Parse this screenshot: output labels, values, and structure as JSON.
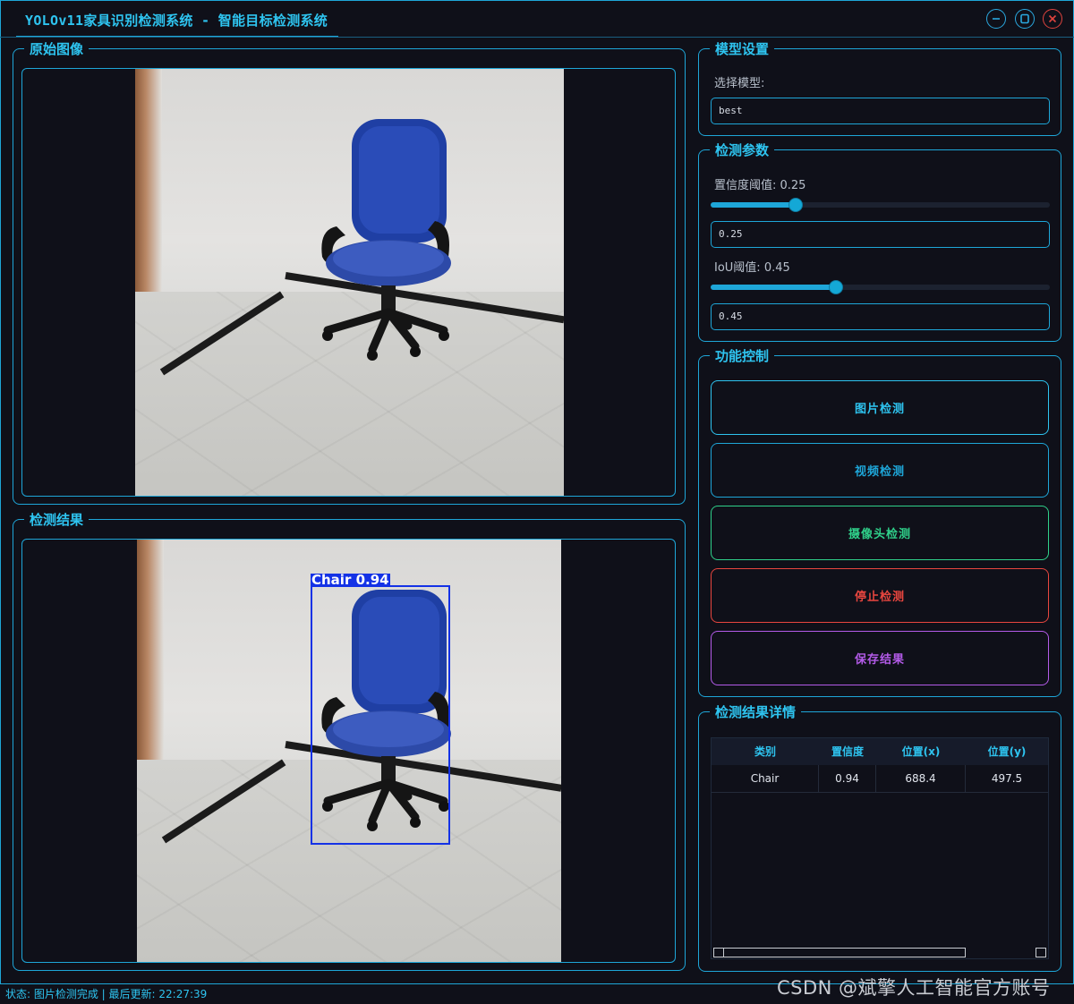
{
  "window": {
    "title": "YOLOv11家具识别检测系统 - 智能目标检测系统"
  },
  "original_panel": {
    "title": "原始图像"
  },
  "result_panel": {
    "title": "检测结果",
    "detection_label": "Chair 0.94"
  },
  "model_settings": {
    "title": "模型设置",
    "select_label": "选择模型:",
    "selected_model": "best"
  },
  "detect_params": {
    "title": "检测参数",
    "confidence_label": "置信度阈值: 0.25",
    "confidence_value": "0.25",
    "confidence_level": 0.25,
    "iou_label": "IoU阈值: 0.45",
    "iou_value": "0.45",
    "iou_level": 0.45
  },
  "controls": {
    "title": "功能控制",
    "buttons": [
      {
        "label": "图片检测",
        "color": "#2ec4f0"
      },
      {
        "label": "视频检测",
        "color": "#1ea6d8"
      },
      {
        "label": "摄像头检测",
        "color": "#2fd08a"
      },
      {
        "label": "停止检测",
        "color": "#e8463f"
      },
      {
        "label": "保存结果",
        "color": "#b35be8"
      }
    ]
  },
  "results_table": {
    "title": "检测结果详情",
    "columns": [
      "类别",
      "置信度",
      "位置(x)",
      "位置(y)"
    ],
    "rows": [
      [
        "Chair",
        "0.94",
        "688.4",
        "497.5"
      ]
    ]
  },
  "status": {
    "text": "状态: 图片检测完成 | 最后更新: 22:27:39"
  },
  "watermark": "CSDN @斌擎人工智能官方账号",
  "icons": {
    "minimize": "minimize-icon",
    "maximize": "maximize-icon",
    "close": "close-icon"
  }
}
